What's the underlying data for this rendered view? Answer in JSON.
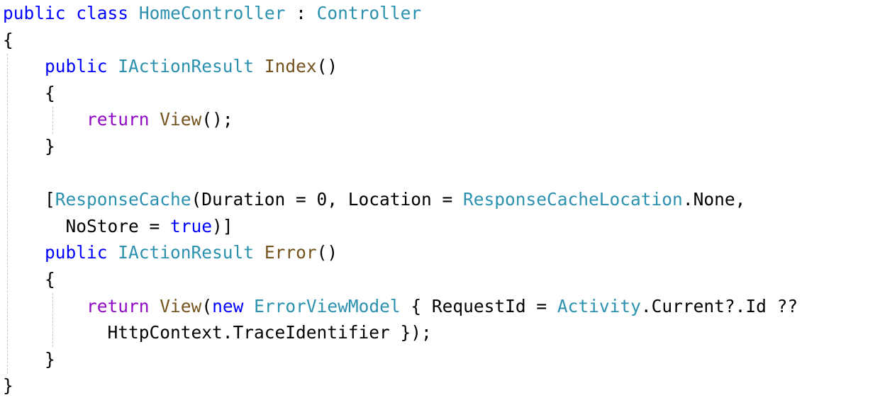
{
  "theme": {
    "background": "#ffffff",
    "plain": "#000000",
    "keyword": "#0000ff",
    "control": "#8f08c4",
    "type": "#2b91af",
    "method": "#74531f",
    "guide": "#c8c8c8"
  },
  "code_lines": [
    [
      {
        "t": "public",
        "k": "keyword"
      },
      {
        "t": " ",
        "k": "plain"
      },
      {
        "t": "class",
        "k": "keyword"
      },
      {
        "t": " ",
        "k": "plain"
      },
      {
        "t": "HomeController",
        "k": "type"
      },
      {
        "t": " : ",
        "k": "plain"
      },
      {
        "t": "Controller",
        "k": "type"
      }
    ],
    [
      {
        "t": "{",
        "k": "plain"
      }
    ],
    [
      {
        "t": "    ",
        "k": "plain"
      },
      {
        "t": "public",
        "k": "keyword"
      },
      {
        "t": " ",
        "k": "plain"
      },
      {
        "t": "IActionResult",
        "k": "type"
      },
      {
        "t": " ",
        "k": "plain"
      },
      {
        "t": "Index",
        "k": "method"
      },
      {
        "t": "()",
        "k": "plain"
      }
    ],
    [
      {
        "t": "    {",
        "k": "plain"
      }
    ],
    [
      {
        "t": "        ",
        "k": "plain"
      },
      {
        "t": "return",
        "k": "control"
      },
      {
        "t": " ",
        "k": "plain"
      },
      {
        "t": "View",
        "k": "method"
      },
      {
        "t": "();",
        "k": "plain"
      }
    ],
    [
      {
        "t": "    }",
        "k": "plain"
      }
    ],
    [
      {
        "t": "",
        "k": "plain"
      }
    ],
    [
      {
        "t": "    [",
        "k": "plain"
      },
      {
        "t": "ResponseCache",
        "k": "type"
      },
      {
        "t": "(Duration = 0, Location = ",
        "k": "plain"
      },
      {
        "t": "ResponseCacheLocation",
        "k": "type"
      },
      {
        "t": ".None,",
        "k": "plain"
      }
    ],
    [
      {
        "t": "      NoStore = ",
        "k": "plain"
      },
      {
        "t": "true",
        "k": "keyword"
      },
      {
        "t": ")]",
        "k": "plain"
      }
    ],
    [
      {
        "t": "    ",
        "k": "plain"
      },
      {
        "t": "public",
        "k": "keyword"
      },
      {
        "t": " ",
        "k": "plain"
      },
      {
        "t": "IActionResult",
        "k": "type"
      },
      {
        "t": " ",
        "k": "plain"
      },
      {
        "t": "Error",
        "k": "method"
      },
      {
        "t": "()",
        "k": "plain"
      }
    ],
    [
      {
        "t": "    {",
        "k": "plain"
      }
    ],
    [
      {
        "t": "        ",
        "k": "plain"
      },
      {
        "t": "return",
        "k": "control"
      },
      {
        "t": " ",
        "k": "plain"
      },
      {
        "t": "View",
        "k": "method"
      },
      {
        "t": "(",
        "k": "plain"
      },
      {
        "t": "new",
        "k": "keyword"
      },
      {
        "t": " ",
        "k": "plain"
      },
      {
        "t": "ErrorViewModel",
        "k": "type"
      },
      {
        "t": " { RequestId = ",
        "k": "plain"
      },
      {
        "t": "Activity",
        "k": "type"
      },
      {
        "t": ".Current?.Id ??",
        "k": "plain"
      }
    ],
    [
      {
        "t": "          HttpContext.TraceIdentifier });",
        "k": "plain"
      }
    ],
    [
      {
        "t": "    }",
        "k": "plain"
      }
    ],
    [
      {
        "t": "}",
        "k": "plain"
      }
    ]
  ]
}
